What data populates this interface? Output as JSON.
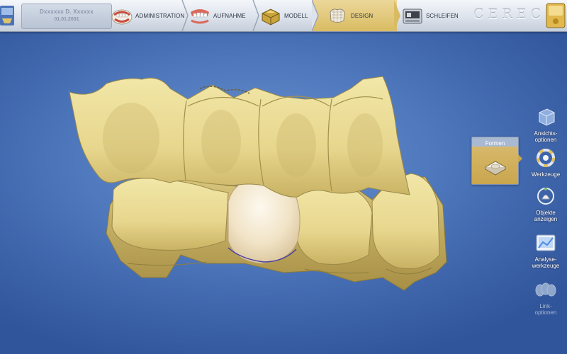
{
  "header": {
    "patient_name": "Dxxxxxx D. Xxxxxx",
    "patient_date": "01.01.2001",
    "steps": [
      {
        "label": "ADMINISTRATION",
        "icon": "administration-icon"
      },
      {
        "label": "AUFNAHME",
        "icon": "acquisition-icon"
      },
      {
        "label": "MODELL",
        "icon": "model-icon"
      },
      {
        "label": "DESIGN",
        "icon": "design-icon",
        "active": true
      },
      {
        "label": "SCHLEIFEN",
        "icon": "milling-icon"
      }
    ],
    "brand": "CEREC"
  },
  "sidebar": {
    "formen": {
      "title": "Formen",
      "icon": "shape-icon"
    },
    "tools": [
      {
        "label": "Ansichts-\noptionen",
        "icon": "view-cube-icon"
      },
      {
        "label": "Werkzeuge",
        "icon": "tools-ring-icon"
      },
      {
        "label": "Objekte\nanzeigen",
        "icon": "objects-icon"
      },
      {
        "label": "Analyse-\nwerkzeuge",
        "icon": "analysis-icon"
      },
      {
        "label": "Link-\noptionen",
        "icon": "link-icon",
        "disabled": true
      }
    ]
  },
  "colors": {
    "accent_active": "#d9bc62",
    "model_gold": "#e9dc97",
    "restoration": "#f2e6cf",
    "background_blue": "#4f78bd"
  }
}
